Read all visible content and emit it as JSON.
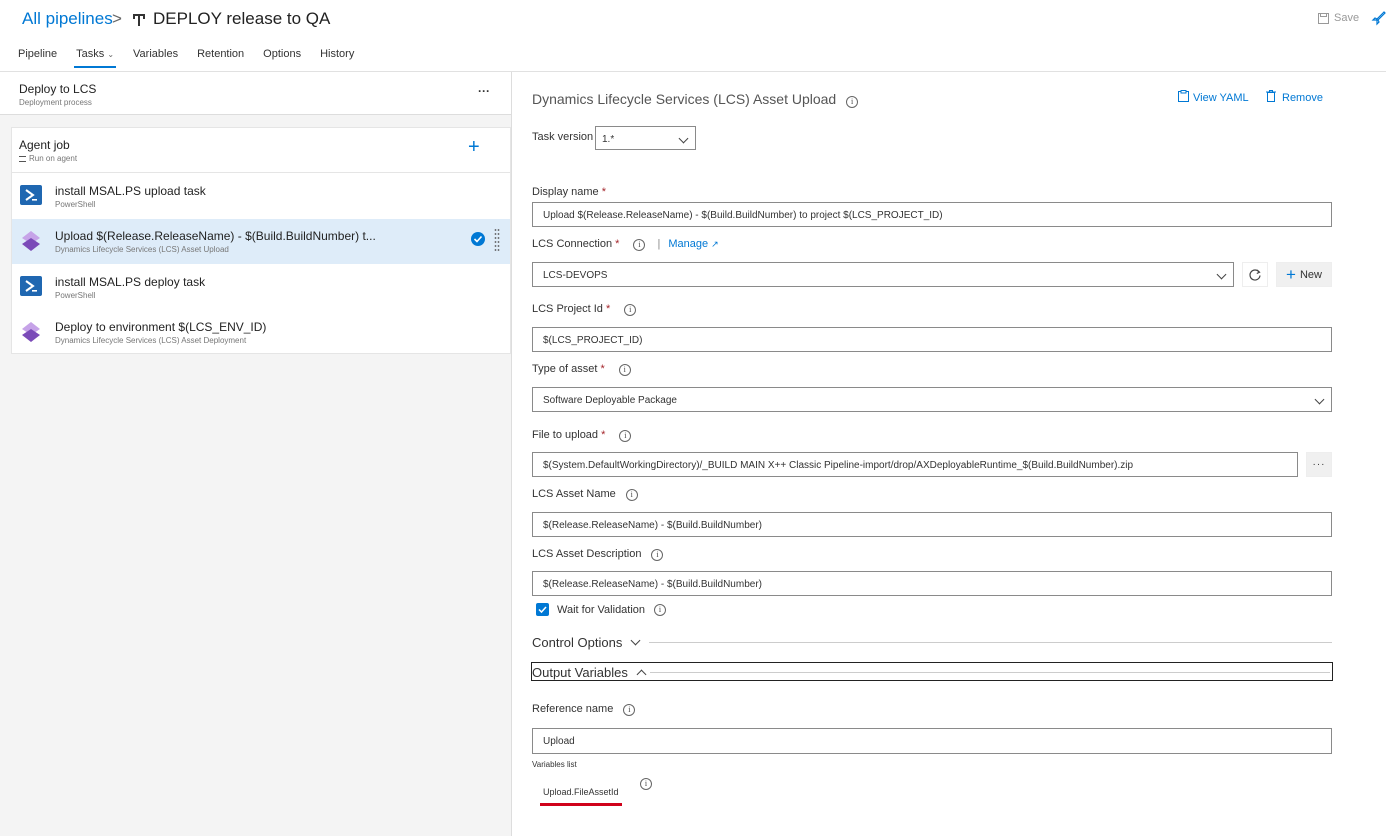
{
  "breadcrumb": {
    "all_pipelines": "All pipelines",
    "separator": ">",
    "title": "DEPLOY release to QA"
  },
  "header": {
    "save_label": "Save"
  },
  "tabs": [
    "Pipeline",
    "Tasks",
    "Variables",
    "Retention",
    "Options",
    "History"
  ],
  "left": {
    "stage": {
      "title": "Deploy to LCS",
      "subtitle": "Deployment process",
      "menu": "···"
    },
    "job": {
      "title": "Agent job",
      "subtitle": "Run on agent"
    },
    "tasks": [
      {
        "name": "install MSAL.PS upload task",
        "sub": "PowerShell"
      },
      {
        "name": "Upload $(Release.ReleaseName) - $(Build.BuildNumber) t...",
        "sub": "Dynamics Lifecycle Services (LCS) Asset Upload"
      },
      {
        "name": "install MSAL.PS deploy task",
        "sub": "PowerShell"
      },
      {
        "name": "Deploy to environment $(LCS_ENV_ID)",
        "sub": "Dynamics Lifecycle Services (LCS) Asset Deployment"
      }
    ]
  },
  "right": {
    "title": "Dynamics Lifecycle Services (LCS) Asset Upload",
    "view_yaml": "View YAML",
    "remove": "Remove",
    "task_version_label": "Task version",
    "task_version_value": "1.*",
    "display_name_label": "Display name",
    "display_name_value": "Upload $(Release.ReleaseName) - $(Build.BuildNumber) to project $(LCS_PROJECT_ID)",
    "lcs_connection_label": "LCS Connection",
    "manage": "Manage",
    "lcs_connection_value": "LCS-DEVOPS",
    "new_label": "New",
    "project_id_label": "LCS Project Id",
    "project_id_value": "$(LCS_PROJECT_ID)",
    "asset_type_label": "Type of asset",
    "asset_type_value": "Software Deployable Package",
    "file_label": "File to upload",
    "file_value": "$(System.DefaultWorkingDirectory)/_BUILD MAIN X++ Classic Pipeline-import/drop/AXDeployableRuntime_$(Build.BuildNumber).zip",
    "asset_name_label": "LCS Asset Name",
    "asset_name_value": "$(Release.ReleaseName) - $(Build.BuildNumber)",
    "asset_desc_label": "LCS Asset Description",
    "asset_desc_value": "$(Release.ReleaseName) - $(Build.BuildNumber)",
    "wait_label": "Wait for Validation",
    "wait_checked": true,
    "control_options": "Control Options",
    "output_variables": "Output Variables",
    "reference_name_label": "Reference name",
    "reference_name_value": "Upload",
    "variables_list_label": "Variables list",
    "variable_item": "Upload.FileAssetId"
  },
  "colors": {
    "accent": "#0078d4",
    "selected_row": "#deecf9",
    "required": "#a4262c",
    "highlight_underline": "#d0021b"
  },
  "icons": [
    "chevron-right-icon",
    "pipeline-icon",
    "save-icon",
    "rocket-icon",
    "more-icon",
    "plus-icon",
    "powershell-icon",
    "lcs-icon",
    "check-circle-icon",
    "drag-handle-icon",
    "info-icon",
    "clipboard-icon",
    "trash-icon",
    "external-link-icon",
    "refresh-icon",
    "chevron-down-icon",
    "chevron-up-icon",
    "checkbox-icon"
  ]
}
